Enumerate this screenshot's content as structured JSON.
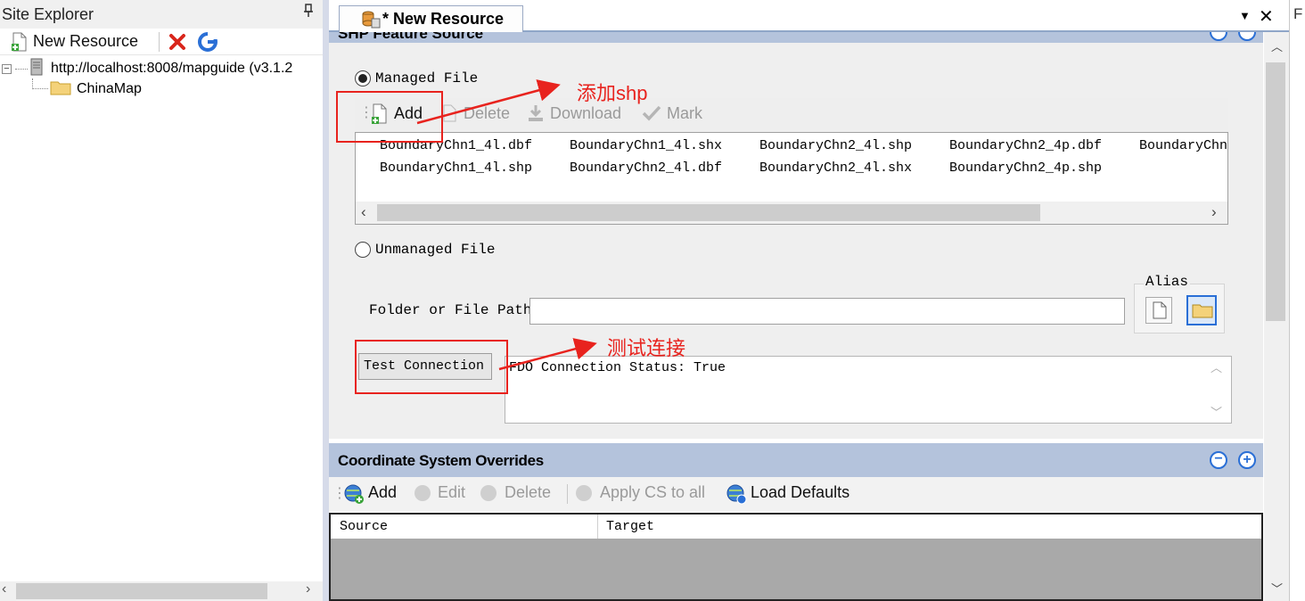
{
  "site_explorer": {
    "title": "Site Explorer",
    "pin_glyph": "ф",
    "new_resource": "New Resource",
    "tree": {
      "server": "http://localhost:8008/mapguide (v3.1.2",
      "folder": "ChinaMap"
    }
  },
  "document": {
    "tab_title": "* New Resource",
    "section_title": "SHP Feature Source",
    "managed_file": "Managed File",
    "file_toolbar": {
      "add": "Add",
      "delete": "Delete",
      "download": "Download",
      "mark": "Mark"
    },
    "files": [
      [
        "BoundaryChn1_4l.dbf",
        "BoundaryChn1_4l.shx",
        "BoundaryChn2_4l.shp",
        "BoundaryChn2_4p.dbf",
        "BoundaryChn"
      ],
      [
        "BoundaryChn1_4l.shp",
        "BoundaryChn2_4l.dbf",
        "BoundaryChn2_4l.shx",
        "BoundaryChn2_4p.shp"
      ]
    ],
    "unmanaged_file": "Unmanaged File",
    "folder_or_file_path": "Folder or File Path",
    "path_value": "",
    "alias": "Alias",
    "test_connection": "Test Connection",
    "status": "FDO Connection Status: True",
    "cs_overrides": {
      "title": "Coordinate System Overrides",
      "toolbar": {
        "add": "Add",
        "edit": "Edit",
        "delete": "Delete",
        "apply": "Apply CS to all",
        "load": "Load Defaults"
      },
      "columns": [
        "Source",
        "Target"
      ]
    }
  },
  "annotations": {
    "add_shp": "添加shp",
    "test_conn": "测试连接"
  },
  "colors": {
    "annotation": "#e8231e",
    "section_header": "#b4c3dc",
    "accent_blue": "#2a6fd6"
  }
}
